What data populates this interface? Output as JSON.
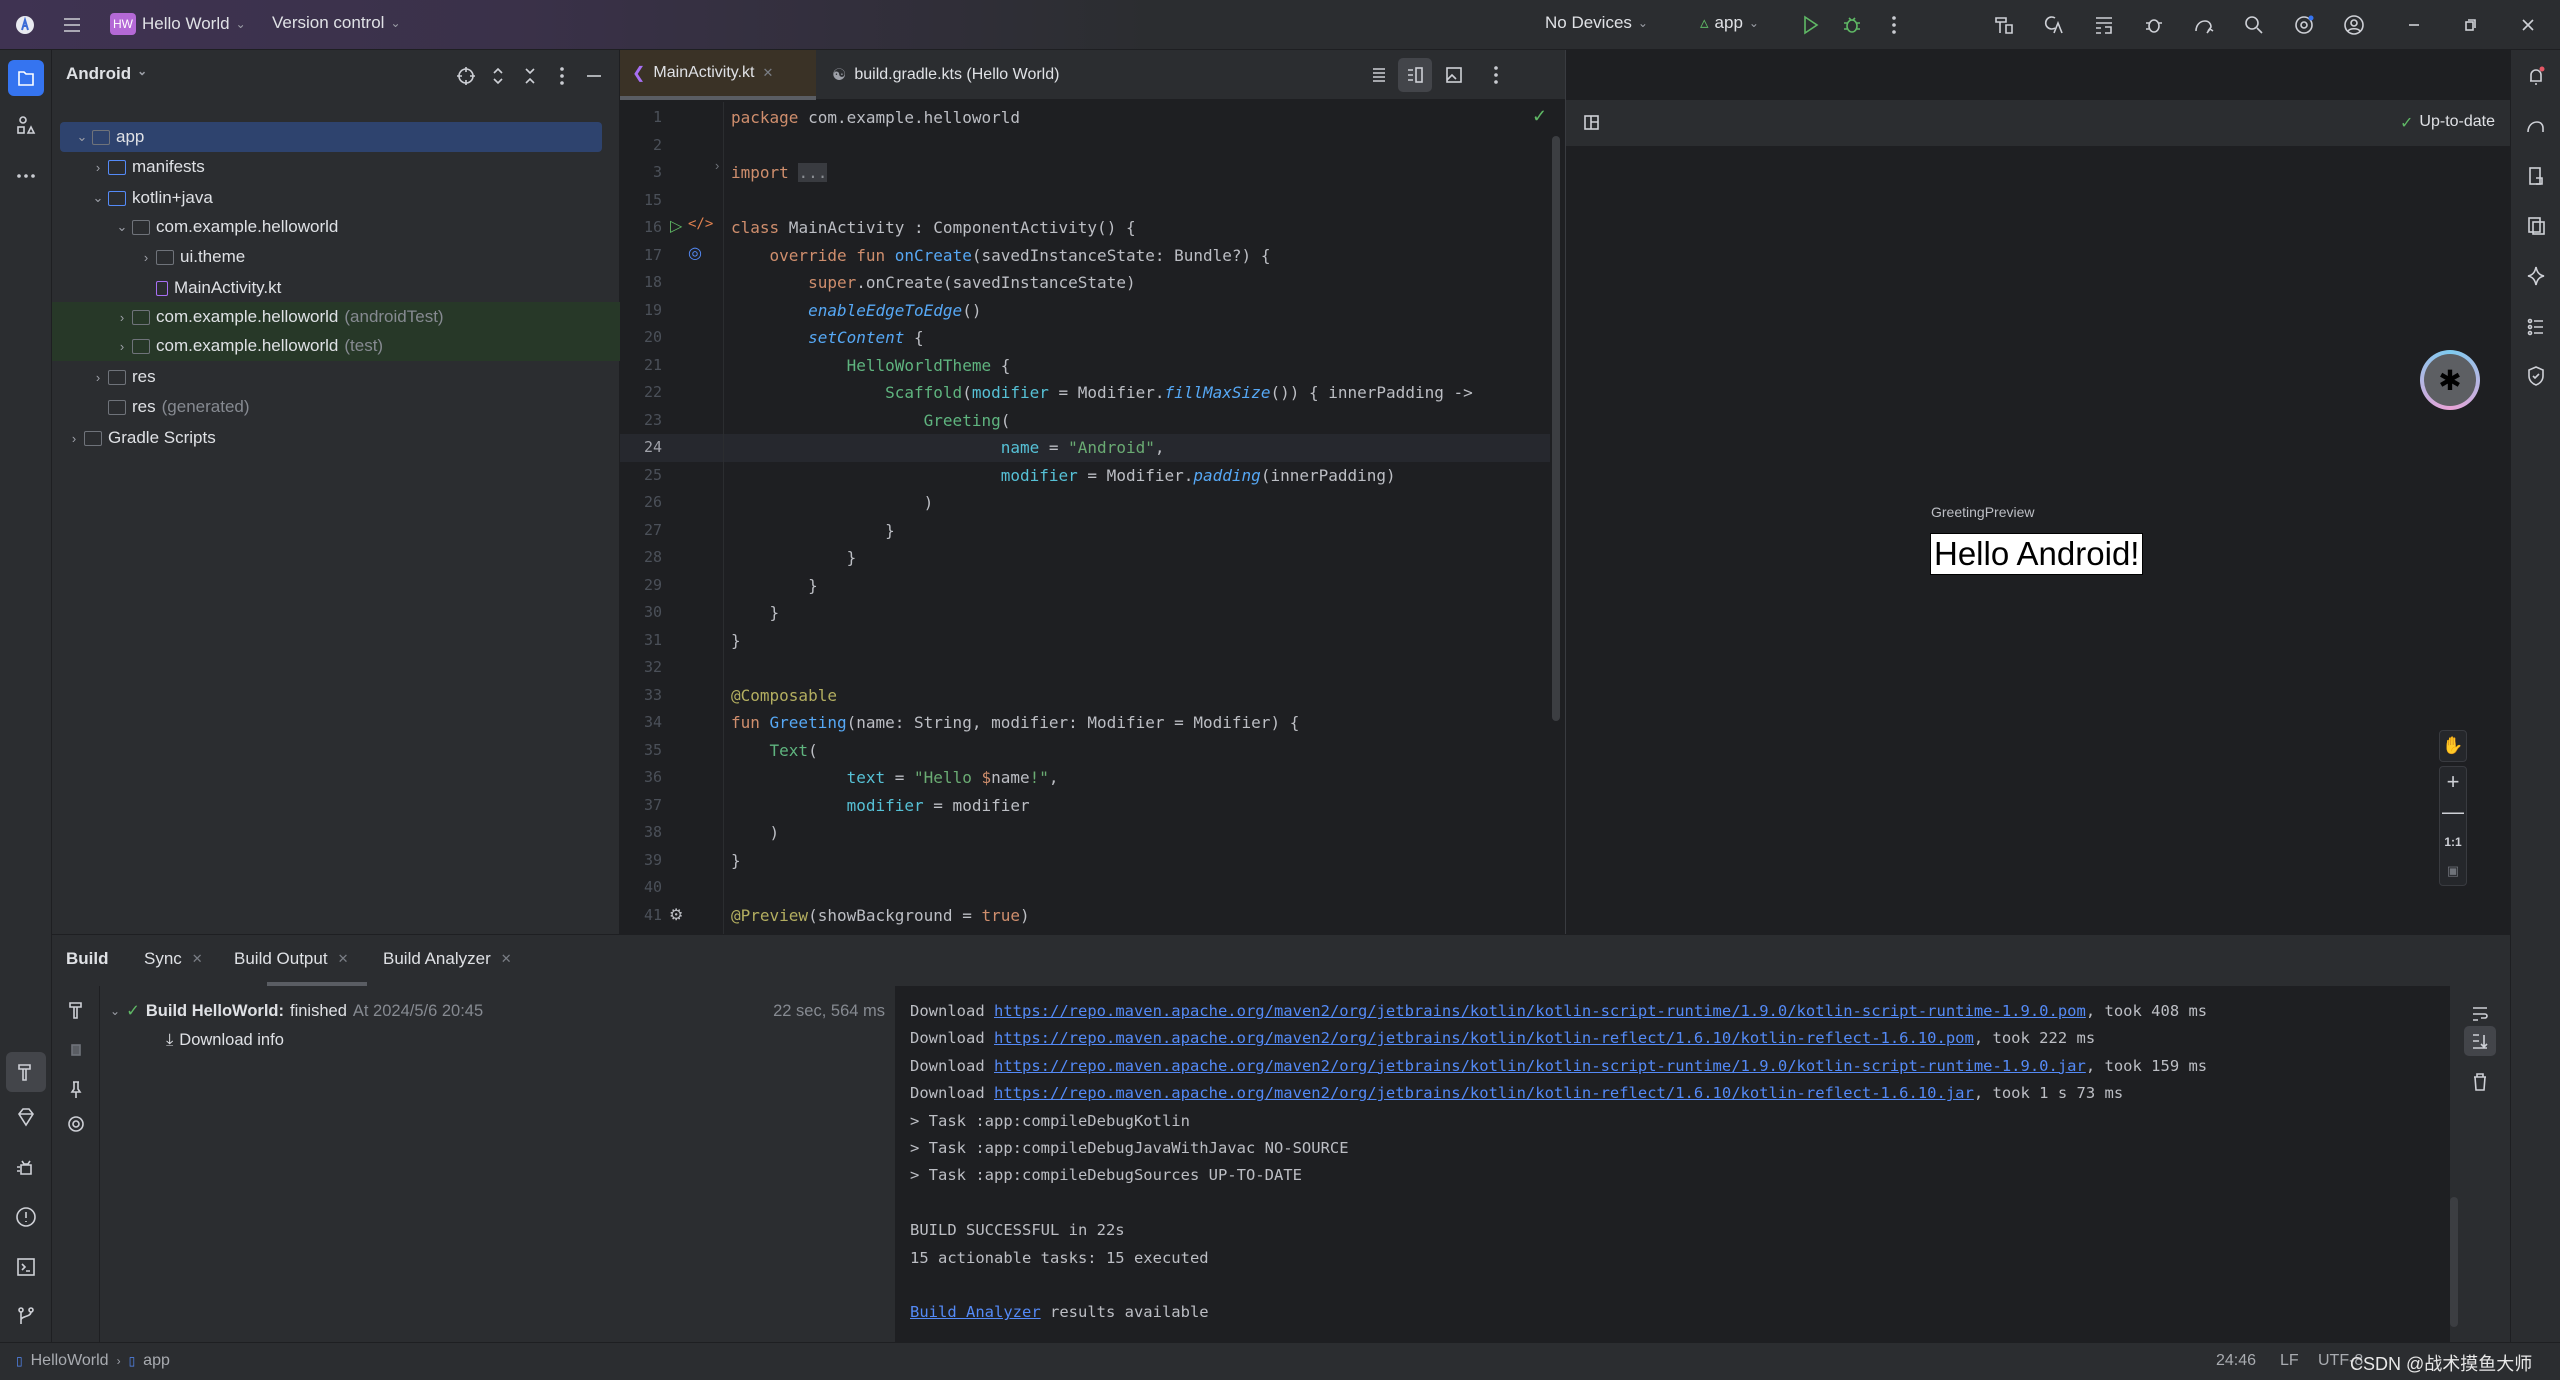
{
  "titlebar": {
    "project_badge": "HW",
    "project_name": "Hello World",
    "version_control": "Version control",
    "device": "No Devices",
    "run_config": "app",
    "badge_color": "#b469d6"
  },
  "project_panel": {
    "title": "Android",
    "tree": [
      {
        "label": "app",
        "suffix": "",
        "level": 0,
        "expanded": true,
        "selected": true,
        "icon": "module-folder-icon"
      },
      {
        "label": "manifests",
        "suffix": "",
        "level": 1,
        "expanded": false,
        "icon": "folder-icon"
      },
      {
        "label": "kotlin+java",
        "suffix": "",
        "level": 1,
        "expanded": true,
        "icon": "folder-icon"
      },
      {
        "label": "com.example.helloworld",
        "suffix": "",
        "level": 2,
        "expanded": true,
        "icon": "package-icon"
      },
      {
        "label": "ui.theme",
        "suffix": "",
        "level": 3,
        "expanded": false,
        "icon": "package-icon"
      },
      {
        "label": "MainActivity.kt",
        "suffix": "",
        "level": 3,
        "leaf": true,
        "icon": "kotlin-file-icon"
      },
      {
        "label": "com.example.helloworld",
        "suffix": "(androidTest)",
        "level": 2,
        "expanded": false,
        "test": true,
        "icon": "package-icon"
      },
      {
        "label": "com.example.helloworld",
        "suffix": "(test)",
        "level": 2,
        "expanded": false,
        "test": true,
        "icon": "package-icon"
      },
      {
        "label": "res",
        "suffix": "",
        "level": 1,
        "expanded": false,
        "icon": "resources-folder-icon"
      },
      {
        "label": "res",
        "suffix": "(generated)",
        "level": 1,
        "leaf": true,
        "icon": "resources-folder-icon"
      },
      {
        "label": "Gradle Scripts",
        "suffix": "",
        "level": 0,
        "expanded": false,
        "icon": "gradle-icon"
      }
    ]
  },
  "editor": {
    "tabs": [
      {
        "label": "MainActivity.kt",
        "active": true
      },
      {
        "label": "build.gradle.kts (Hello World)",
        "active": false
      }
    ],
    "current_line": "24",
    "lines": [
      {
        "n": "1",
        "t": [
          [
            "package",
            "kw"
          ],
          [
            " com.example.helloworld",
            ""
          ]
        ]
      },
      {
        "n": "2",
        "t": []
      },
      {
        "n": "3",
        "t": [
          [
            "import",
            "kw"
          ],
          [
            " ",
            ""
          ],
          [
            "...",
            "fo"
          ]
        ]
      },
      {
        "n": "15",
        "t": []
      },
      {
        "n": "16",
        "t": [
          [
            "class",
            "kw"
          ],
          [
            " MainActivity : ComponentActivity() {",
            ""
          ]
        ]
      },
      {
        "n": "17",
        "t": [
          [
            "    override fun ",
            "kw"
          ],
          [
            "onCreate",
            "fn"
          ],
          [
            "(savedInstanceState: Bundle?) {",
            ""
          ]
        ]
      },
      {
        "n": "18",
        "t": [
          [
            "        super",
            "kw"
          ],
          [
            ".onCreate(savedInstanceState)",
            ""
          ]
        ]
      },
      {
        "n": "19",
        "t": [
          [
            "        ",
            ""
          ],
          [
            "enableEdgeToEdge",
            "it"
          ],
          [
            "()",
            ""
          ]
        ]
      },
      {
        "n": "20",
        "t": [
          [
            "        ",
            ""
          ],
          [
            "setContent",
            "it"
          ],
          [
            " {",
            ""
          ]
        ]
      },
      {
        "n": "21",
        "t": [
          [
            "            ",
            ""
          ],
          [
            "HelloWorldTheme",
            "cp"
          ],
          [
            " {",
            ""
          ]
        ]
      },
      {
        "n": "22",
        "t": [
          [
            "                ",
            ""
          ],
          [
            "Scaffold",
            "cp"
          ],
          [
            "(",
            ""
          ],
          [
            "modifier",
            "na"
          ],
          [
            " = Modifier.",
            ""
          ],
          [
            "fillMaxSize",
            "it"
          ],
          [
            "()) { innerPadding ->",
            ""
          ]
        ]
      },
      {
        "n": "23",
        "t": [
          [
            "                    ",
            ""
          ],
          [
            "Greeting",
            "cp"
          ],
          [
            "(",
            ""
          ]
        ]
      },
      {
        "n": "24",
        "t": [
          [
            "                            ",
            ""
          ],
          [
            "name",
            "na"
          ],
          [
            " = ",
            ""
          ],
          [
            "\"Android\"",
            "st"
          ],
          [
            ",",
            ""
          ]
        ]
      },
      {
        "n": "25",
        "t": [
          [
            "                            ",
            ""
          ],
          [
            "modifier",
            "na"
          ],
          [
            " = Modifier.",
            ""
          ],
          [
            "padding",
            "it"
          ],
          [
            "(innerPadding)",
            ""
          ]
        ]
      },
      {
        "n": "26",
        "t": [
          [
            "                    )",
            ""
          ]
        ]
      },
      {
        "n": "27",
        "t": [
          [
            "                }",
            ""
          ]
        ]
      },
      {
        "n": "28",
        "t": [
          [
            "            }",
            ""
          ]
        ]
      },
      {
        "n": "29",
        "t": [
          [
            "        }",
            ""
          ]
        ]
      },
      {
        "n": "30",
        "t": [
          [
            "    }",
            ""
          ]
        ]
      },
      {
        "n": "31",
        "t": [
          [
            "}",
            ""
          ]
        ]
      },
      {
        "n": "32",
        "t": []
      },
      {
        "n": "33",
        "t": [
          [
            "@Composable",
            "an"
          ]
        ]
      },
      {
        "n": "34",
        "t": [
          [
            "fun ",
            "kw"
          ],
          [
            "Greeting",
            "fn"
          ],
          [
            "(name: String, modifier: Modifier = Modifier) {",
            ""
          ]
        ]
      },
      {
        "n": "35",
        "t": [
          [
            "    ",
            ""
          ],
          [
            "Text",
            "cp"
          ],
          [
            "(",
            ""
          ]
        ]
      },
      {
        "n": "36",
        "t": [
          [
            "            ",
            ""
          ],
          [
            "text",
            "na"
          ],
          [
            " = ",
            ""
          ],
          [
            "\"Hello ",
            "st"
          ],
          [
            "$",
            "kw"
          ],
          [
            "name",
            ""
          ],
          [
            "!\"",
            "st"
          ],
          [
            ",",
            ""
          ]
        ]
      },
      {
        "n": "37",
        "t": [
          [
            "            ",
            ""
          ],
          [
            "modifier",
            "na"
          ],
          [
            " = modifier",
            ""
          ]
        ]
      },
      {
        "n": "38",
        "t": [
          [
            "    )",
            ""
          ]
        ]
      },
      {
        "n": "39",
        "t": [
          [
            "}",
            ""
          ]
        ]
      },
      {
        "n": "40",
        "t": []
      },
      {
        "n": "41",
        "t": [
          [
            "@Preview",
            "an"
          ],
          [
            "(showBackground = ",
            ""
          ],
          [
            "true",
            "kw"
          ],
          [
            ")",
            ""
          ]
        ]
      }
    ]
  },
  "preview": {
    "status": "Up-to-date",
    "preview_name": "GreetingPreview",
    "rendered_text": "Hello Android!",
    "zoom_reset": "1:1"
  },
  "build_panel": {
    "title": "Build",
    "tabs": [
      {
        "label": "Sync",
        "active": false
      },
      {
        "label": "Build Output",
        "active": true
      },
      {
        "label": "Build Analyzer",
        "active": false
      }
    ],
    "tree": {
      "title": "Build HelloWorld:",
      "status": "finished",
      "timestamp": "At 2024/5/6 20:45",
      "duration": "22 sec, 564 ms",
      "child": "Download info"
    },
    "console": [
      [
        [
          "Download ",
          ""
        ],
        [
          "https://repo.maven.apache.org/maven2/org/jetbrains/kotlin/kotlin-script-runtime/1.9.0/kotlin-script-runtime-1.9.0.pom",
          "lnk"
        ],
        [
          ", took 408 ms",
          ""
        ]
      ],
      [
        [
          "Download ",
          ""
        ],
        [
          "https://repo.maven.apache.org/maven2/org/jetbrains/kotlin/kotlin-reflect/1.6.10/kotlin-reflect-1.6.10.pom",
          "lnk"
        ],
        [
          ", took 222 ms",
          ""
        ]
      ],
      [
        [
          "Download ",
          ""
        ],
        [
          "https://repo.maven.apache.org/maven2/org/jetbrains/kotlin/kotlin-script-runtime/1.9.0/kotlin-script-runtime-1.9.0.jar",
          "lnk"
        ],
        [
          ", took 159 ms",
          ""
        ]
      ],
      [
        [
          "Download ",
          ""
        ],
        [
          "https://repo.maven.apache.org/maven2/org/jetbrains/kotlin/kotlin-reflect/1.6.10/kotlin-reflect-1.6.10.jar",
          "lnk"
        ],
        [
          ", took 1 s 73 ms",
          ""
        ]
      ],
      [
        [
          "> Task :app:compileDebugKotlin",
          ""
        ]
      ],
      [
        [
          "> Task :app:compileDebugJavaWithJavac NO-SOURCE",
          ""
        ]
      ],
      [
        [
          "> Task :app:compileDebugSources UP-TO-DATE",
          ""
        ]
      ],
      [],
      [
        [
          "BUILD SUCCESSFUL in 22s",
          ""
        ]
      ],
      [
        [
          "15 actionable tasks: 15 executed",
          ""
        ]
      ],
      [],
      [
        [
          "Build Analyzer",
          "lnk"
        ],
        [
          " results available",
          ""
        ]
      ]
    ]
  },
  "statusbar": {
    "breadcrumb": [
      "HelloWorld",
      "app"
    ],
    "position": "24:46",
    "line_sep": "LF",
    "encoding": "UTF-8",
    "watermark": "CSDN @战术摸鱼大师"
  }
}
